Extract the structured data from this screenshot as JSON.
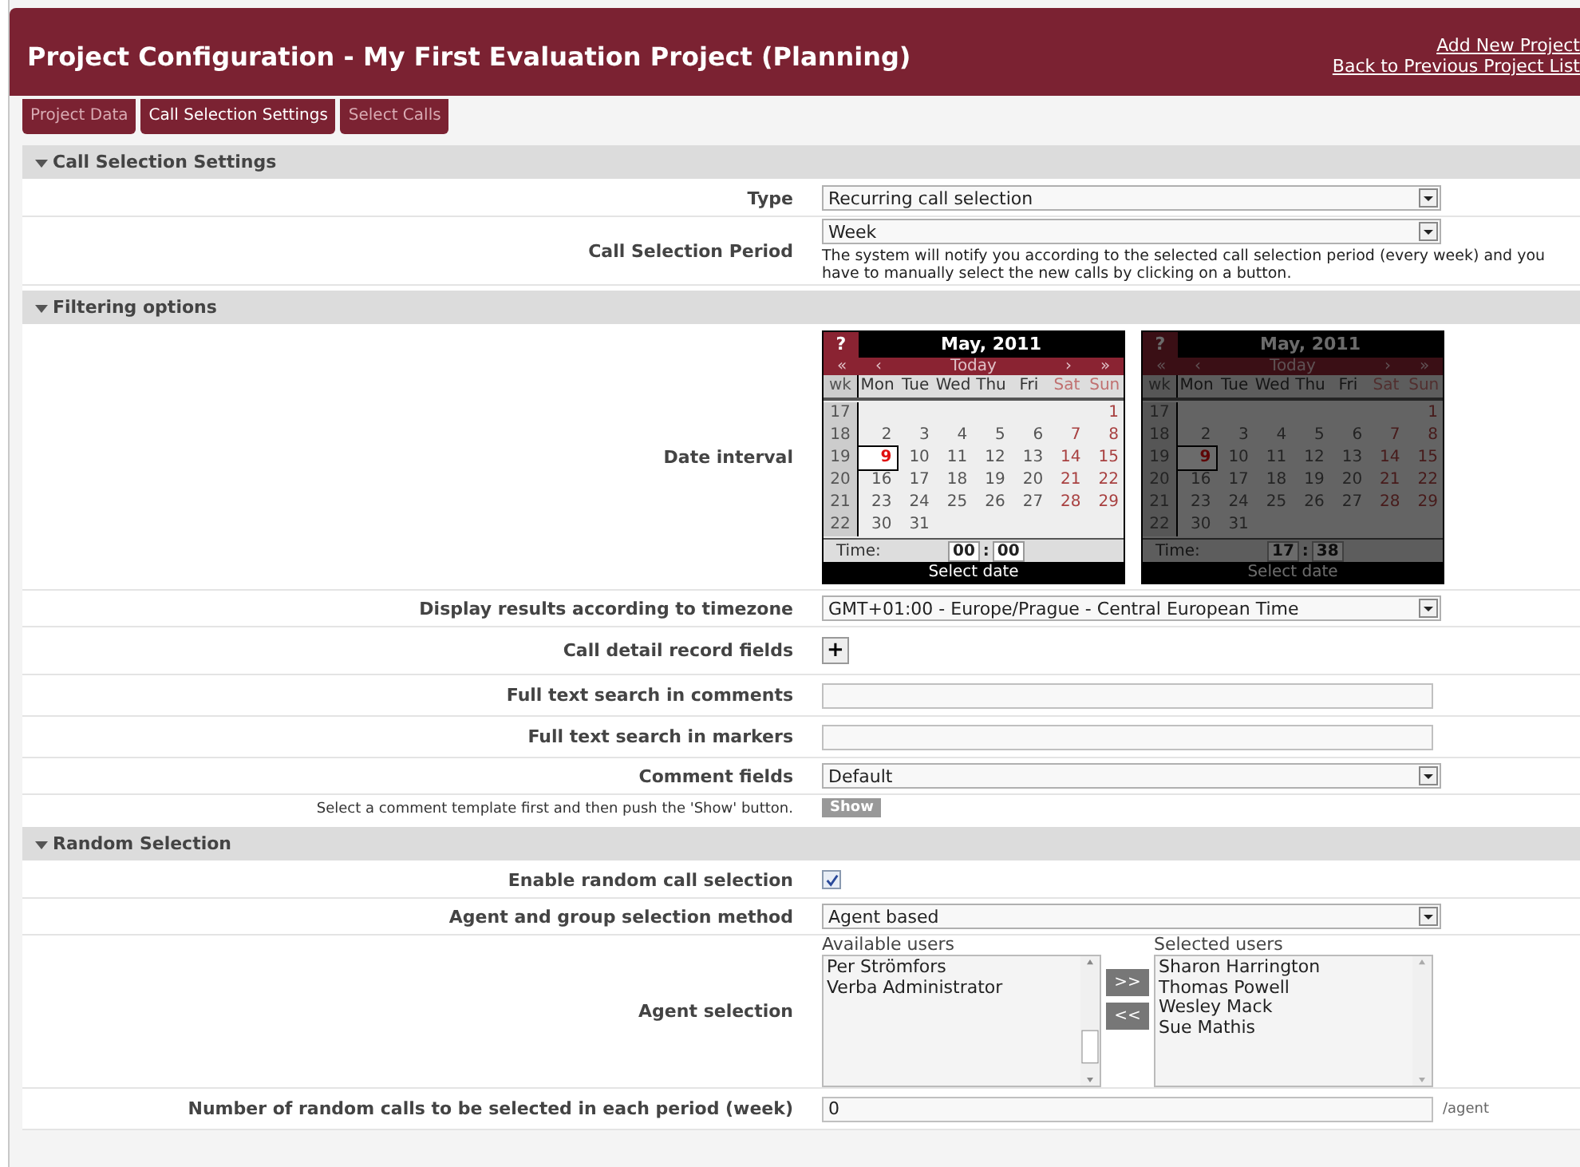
{
  "header": {
    "title": "Project Configuration - My First Evaluation Project (Planning)",
    "links": [
      "Add New Project",
      "Back to Previous Project List"
    ]
  },
  "tabs": [
    {
      "label": "Project Data",
      "selected": false
    },
    {
      "label": "Call Selection Settings",
      "selected": true
    },
    {
      "label": "Select Calls",
      "selected": false
    }
  ],
  "sections": [
    {
      "title": "Call Selection Settings",
      "expanded": true,
      "rows": [
        {
          "kind": "select",
          "label": "Type",
          "value": "Recurring call selection"
        },
        {
          "kind": "select",
          "label": "Call Selection Period",
          "value": "Week",
          "note": "The system will notify you according to the selected call selection period (every week) and you have to manually select the new calls by clicking on a button."
        }
      ]
    },
    {
      "title": "Filtering options",
      "expanded": true,
      "rows": [
        {
          "kind": "calendars",
          "label": "Date interval",
          "calendars": [
            {
              "disabled": false,
              "help": "?",
              "title": "May, 2011",
              "nav": [
                "«",
                "‹",
                "Today",
                "›",
                "»"
              ],
              "week_label": "wk",
              "weekdays": [
                "Mon",
                "Tue",
                "Wed",
                "Thu",
                "Fri",
                "Sat",
                "Sun"
              ],
              "weeks": [
                {
                  "wk": "17",
                  "starts_late": true,
                  "days": [
                    {
                      "d": "1",
                      "selected": false
                    }
                  ]
                },
                {
                  "wk": "18",
                  "days": [
                    {
                      "d": "2",
                      "selected": false
                    },
                    {
                      "d": "3",
                      "selected": false
                    },
                    {
                      "d": "4",
                      "selected": false
                    },
                    {
                      "d": "5",
                      "selected": false
                    },
                    {
                      "d": "6",
                      "selected": false
                    },
                    {
                      "d": "7",
                      "selected": false
                    },
                    {
                      "d": "8",
                      "selected": false
                    }
                  ]
                },
                {
                  "wk": "19",
                  "days": [
                    {
                      "d": "9",
                      "selected": true
                    },
                    {
                      "d": "10",
                      "selected": false
                    },
                    {
                      "d": "11",
                      "selected": false
                    },
                    {
                      "d": "12",
                      "selected": false
                    },
                    {
                      "d": "13",
                      "selected": false
                    },
                    {
                      "d": "14",
                      "selected": false
                    },
                    {
                      "d": "15",
                      "selected": false
                    }
                  ]
                },
                {
                  "wk": "20",
                  "days": [
                    {
                      "d": "16",
                      "selected": false
                    },
                    {
                      "d": "17",
                      "selected": false
                    },
                    {
                      "d": "18",
                      "selected": false
                    },
                    {
                      "d": "19",
                      "selected": false
                    },
                    {
                      "d": "20",
                      "selected": false
                    },
                    {
                      "d": "21",
                      "selected": false
                    },
                    {
                      "d": "22",
                      "selected": false
                    }
                  ]
                },
                {
                  "wk": "21",
                  "days": [
                    {
                      "d": "23",
                      "selected": false
                    },
                    {
                      "d": "24",
                      "selected": false
                    },
                    {
                      "d": "25",
                      "selected": false
                    },
                    {
                      "d": "26",
                      "selected": false
                    },
                    {
                      "d": "27",
                      "selected": false
                    },
                    {
                      "d": "28",
                      "selected": false
                    },
                    {
                      "d": "29",
                      "selected": false
                    }
                  ]
                },
                {
                  "wk": "22",
                  "starts_late": false,
                  "days": [
                    {
                      "d": "30",
                      "selected": false
                    },
                    {
                      "d": "31",
                      "selected": false
                    }
                  ]
                }
              ],
              "time": {
                "label": "Time:",
                "hour": "00",
                "sep": ":",
                "minute": "00"
              },
              "footer": "Select date"
            },
            {
              "disabled": true,
              "help": "?",
              "title": "May, 2011",
              "nav": [
                "«",
                "‹",
                "Today",
                "›",
                "»"
              ],
              "week_label": "wk",
              "weekdays": [
                "Mon",
                "Tue",
                "Wed",
                "Thu",
                "Fri",
                "Sat",
                "Sun"
              ],
              "weeks": [
                {
                  "wk": "17",
                  "starts_late": true,
                  "days": [
                    {
                      "d": "1",
                      "selected": false
                    }
                  ]
                },
                {
                  "wk": "18",
                  "days": [
                    {
                      "d": "2",
                      "selected": false
                    },
                    {
                      "d": "3",
                      "selected": false
                    },
                    {
                      "d": "4",
                      "selected": false
                    },
                    {
                      "d": "5",
                      "selected": false
                    },
                    {
                      "d": "6",
                      "selected": false
                    },
                    {
                      "d": "7",
                      "selected": false
                    },
                    {
                      "d": "8",
                      "selected": false
                    }
                  ]
                },
                {
                  "wk": "19",
                  "days": [
                    {
                      "d": "9",
                      "selected": true
                    },
                    {
                      "d": "10",
                      "selected": false
                    },
                    {
                      "d": "11",
                      "selected": false
                    },
                    {
                      "d": "12",
                      "selected": false
                    },
                    {
                      "d": "13",
                      "selected": false
                    },
                    {
                      "d": "14",
                      "selected": false
                    },
                    {
                      "d": "15",
                      "selected": false
                    }
                  ]
                },
                {
                  "wk": "20",
                  "days": [
                    {
                      "d": "16",
                      "selected": false
                    },
                    {
                      "d": "17",
                      "selected": false
                    },
                    {
                      "d": "18",
                      "selected": false
                    },
                    {
                      "d": "19",
                      "selected": false
                    },
                    {
                      "d": "20",
                      "selected": false
                    },
                    {
                      "d": "21",
                      "selected": false
                    },
                    {
                      "d": "22",
                      "selected": false
                    }
                  ]
                },
                {
                  "wk": "21",
                  "days": [
                    {
                      "d": "23",
                      "selected": false
                    },
                    {
                      "d": "24",
                      "selected": false
                    },
                    {
                      "d": "25",
                      "selected": false
                    },
                    {
                      "d": "26",
                      "selected": false
                    },
                    {
                      "d": "27",
                      "selected": false
                    },
                    {
                      "d": "28",
                      "selected": false
                    },
                    {
                      "d": "29",
                      "selected": false
                    }
                  ]
                },
                {
                  "wk": "22",
                  "starts_late": false,
                  "days": [
                    {
                      "d": "30",
                      "selected": false
                    },
                    {
                      "d": "31",
                      "selected": false
                    }
                  ]
                }
              ],
              "time": {
                "label": "Time:",
                "hour": "17",
                "sep": ":",
                "minute": "38"
              },
              "footer": "Select date"
            }
          ]
        },
        {
          "kind": "select",
          "label": "Display results according to timezone",
          "value": "GMT+01:00 - Europe/Prague - Central European Time"
        },
        {
          "kind": "add",
          "label": "Call detail record fields",
          "button": "+"
        },
        {
          "kind": "text",
          "label": "Full text search in comments"
        },
        {
          "kind": "text",
          "label": "Full text search in markers"
        },
        {
          "kind": "select",
          "label": "Comment fields",
          "value": "Default",
          "hint": "Select a comment template first and then push the 'Show' button.",
          "button": "Show"
        }
      ]
    },
    {
      "title": "Random Selection",
      "expanded": true,
      "rows": [
        {
          "kind": "checkbox",
          "label": "Enable random call selection",
          "checked": true
        },
        {
          "kind": "select",
          "label": "Agent and group selection method",
          "value": "Agent based"
        },
        {
          "kind": "dual_list",
          "label": "Agent selection",
          "available_label": "Available users",
          "available": [
            "Per Strömfors",
            "Verba Administrator"
          ],
          "add_button": ">>",
          "remove_button": "<<",
          "selected_label": "Selected users",
          "selected": [
            "Sharon Harrington",
            "Thomas Powell",
            "Wesley Mack",
            "Sue Mathis"
          ]
        },
        {
          "kind": "text",
          "label": "Number of random calls to be selected in each period (week)",
          "value": "0",
          "suffix": "/agent"
        }
      ]
    }
  ]
}
